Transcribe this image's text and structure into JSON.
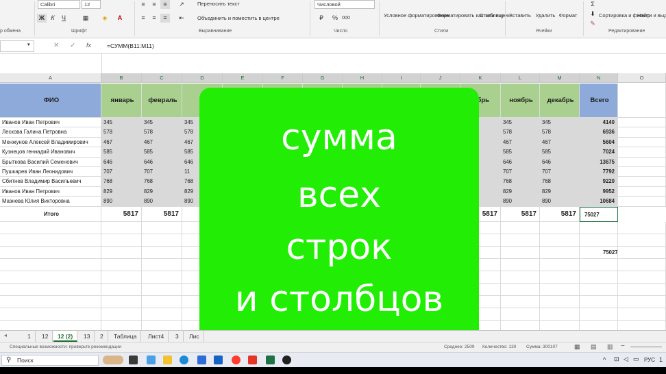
{
  "ribbon": {
    "font_name": "Calibri",
    "font_size": "12",
    "number_format": "Числовой",
    "wrap_text": "Переносить текст",
    "merge_center": "Объединить и поместить в центре",
    "conditional_formatting": "Условное форматирование",
    "format_as_table": "Форматировать как таблицу",
    "cell_styles": "Стили ячеек",
    "insert": "Вставить",
    "delete": "Удалить",
    "format": "Формат",
    "sort_filter": "Сортировка и фильтр",
    "find_select": "Найти и выделить",
    "group_clipboard": "р обмена",
    "group_font": "Шрифт",
    "group_alignment": "Выравнивание",
    "group_number": "Число",
    "group_styles": "Стили",
    "group_cells": "Ячейки",
    "group_editing": "Редактирование",
    "bold": "Ж",
    "italic": "К",
    "underline": "Ч",
    "percent": "%",
    "thousands": "000"
  },
  "formula_bar": {
    "name_box": "",
    "formula": "=СУММ(B11:M11)",
    "cancel": "✕",
    "enter": "✓",
    "fx": "fx"
  },
  "columns": [
    "A",
    "B",
    "C",
    "D",
    "E",
    "F",
    "G",
    "H",
    "I",
    "J",
    "K",
    "L",
    "M",
    "N",
    "O"
  ],
  "table": {
    "header_fio": "ФИО",
    "months_left": [
      "январь",
      "февраль",
      "м"
    ],
    "months_right": [
      "ябрь",
      "ноябрь",
      "декабрь"
    ],
    "header_total": "Всего",
    "rows": [
      {
        "name": "Иванов Иван Петрович",
        "b": "345",
        "c": "345",
        "d": "345",
        "l": "345",
        "m": "345",
        "total": "4140"
      },
      {
        "name": "Лескова Галина Петровна",
        "b": "578",
        "c": "578",
        "d": "578",
        "l": "578",
        "m": "578",
        "total": "6936"
      },
      {
        "name": "Менжунов Алексей Владимирович",
        "b": "467",
        "c": "467",
        "d": "467",
        "l": "467",
        "m": "467",
        "total": "5604"
      },
      {
        "name": "Кузнецов геннадий Иванович",
        "b": "585",
        "c": "585",
        "d": "585",
        "l": "585",
        "m": "585",
        "total": "7024"
      },
      {
        "name": "Брыткова Василий Семенович",
        "b": "646",
        "c": "646",
        "d": "646",
        "l": "646",
        "m": "646",
        "total": "13675"
      },
      {
        "name": "Пушкарев Иван Леонидович",
        "b": "707",
        "c": "707",
        "d": "11",
        "l": "707",
        "m": "707",
        "total": "7792"
      },
      {
        "name": "Сбитнев Владимир Васильевич",
        "b": "768",
        "c": "768",
        "d": "768",
        "l": "768",
        "m": "768",
        "total": "9220"
      },
      {
        "name": "Иванов Иван Петрович",
        "b": "829",
        "c": "829",
        "d": "829",
        "l": "829",
        "m": "829",
        "total": "9952"
      },
      {
        "name": "Мазнева Юлия Викторовна",
        "b": "890",
        "c": "890",
        "d": "890",
        "l": "890",
        "m": "890",
        "total": "10684"
      }
    ],
    "total_label": "Итого",
    "total_b": "5817",
    "total_c": "5817",
    "total_k": "5817",
    "total_l": "5817",
    "total_m": "5817",
    "grand_total": "75027",
    "extra_total": "75027"
  },
  "overlay": {
    "lines": [
      "сумма",
      "всех",
      "строк",
      "и столбцов"
    ],
    "color": "#22ee05"
  },
  "sheet_tabs": [
    "1",
    "12",
    "12 (2)",
    "13",
    "2",
    "Таблица",
    "Лист4",
    "3",
    "Лис"
  ],
  "active_tab": "12 (2)",
  "status": {
    "left": "Специальные возможности: проверьте рекомендации",
    "average": "Среднее: 2509",
    "count": "Количество: 130",
    "sum": "Сумма: 300107"
  },
  "taskbar": {
    "search": "Поиск",
    "lang": "РУС",
    "time": "1"
  }
}
